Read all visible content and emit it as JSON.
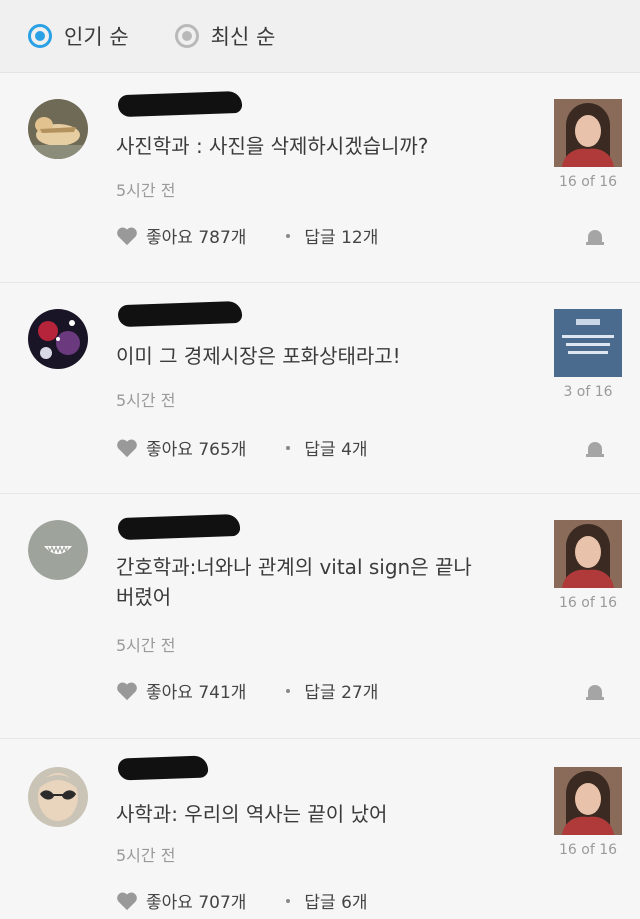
{
  "sort": {
    "popular": "인기 순",
    "recent": "최신 순",
    "selected": "popular"
  },
  "comments": [
    {
      "text": "사진학과 : 사진을 삭제하시겠습니까?",
      "time": "5시간 전",
      "likes": "좋아요 787개",
      "replies": "답글 12개",
      "thumb_count": "16 of 16",
      "avatar_icon": "kitten-photo",
      "thumb_icon": "woman-photo"
    },
    {
      "text": "이미 그 경제시장은 포화상태라고!",
      "time": "5시간 전",
      "likes": "좋아요 765개",
      "replies": "답글 4개",
      "thumb_count": "3 of 16",
      "avatar_icon": "galaxy-photo",
      "thumb_icon": "text-card"
    },
    {
      "text": "간호학과:너와나 관계의 vital sign은 끝나버렸어",
      "time": "5시간 전",
      "likes": "좋아요 741개",
      "replies": "답글 27개",
      "thumb_count": "16 of 16",
      "avatar_icon": "default-smile-avatar",
      "thumb_icon": "woman-photo"
    },
    {
      "text": "사학과: 우리의 역사는 끝이 났어",
      "time": "5시간 전",
      "likes": "좋아요 707개",
      "replies": "답글 6개",
      "thumb_count": "16 of 16",
      "avatar_icon": "person-sunglasses-photo",
      "thumb_icon": "woman-photo"
    }
  ],
  "colors": {
    "accent": "#2aa1e4",
    "muted": "#9a9a9a"
  }
}
